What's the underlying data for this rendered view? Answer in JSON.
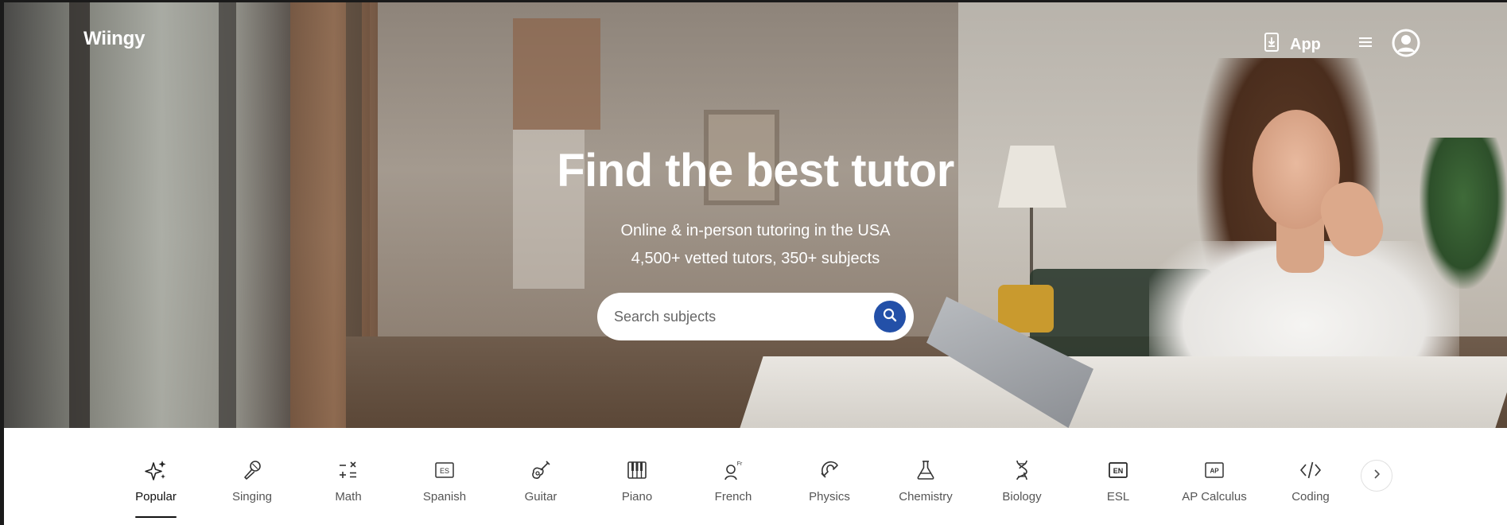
{
  "header": {
    "logo": "Wiingy",
    "app_label": "App"
  },
  "hero": {
    "title": "Find the best tutor",
    "subtitle_line1": "Online & in-person tutoring in the USA",
    "subtitle_line2": "4,500+ vetted tutors, 350+ subjects"
  },
  "search": {
    "placeholder": "Search subjects"
  },
  "categories": [
    {
      "label": "Popular",
      "icon": "sparkle-icon",
      "active": true
    },
    {
      "label": "Singing",
      "icon": "microphone-icon"
    },
    {
      "label": "Math",
      "icon": "math-operators-icon"
    },
    {
      "label": "Spanish",
      "icon": "es-icon",
      "icon_text": "ES"
    },
    {
      "label": "Guitar",
      "icon": "guitar-icon"
    },
    {
      "label": "Piano",
      "icon": "piano-icon"
    },
    {
      "label": "French",
      "icon": "french-speaker-icon",
      "icon_text": "Fr"
    },
    {
      "label": "Physics",
      "icon": "magnet-icon"
    },
    {
      "label": "Chemistry",
      "icon": "flask-icon"
    },
    {
      "label": "Biology",
      "icon": "dna-icon"
    },
    {
      "label": "ESL",
      "icon": "en-icon",
      "icon_text": "EN"
    },
    {
      "label": "AP Calculus",
      "icon": "ap-icon",
      "icon_text": "AP"
    },
    {
      "label": "Coding",
      "icon": "code-icon"
    }
  ],
  "colors": {
    "accent": "#2350a8",
    "text_dark": "#111111",
    "text_muted": "#555555"
  }
}
